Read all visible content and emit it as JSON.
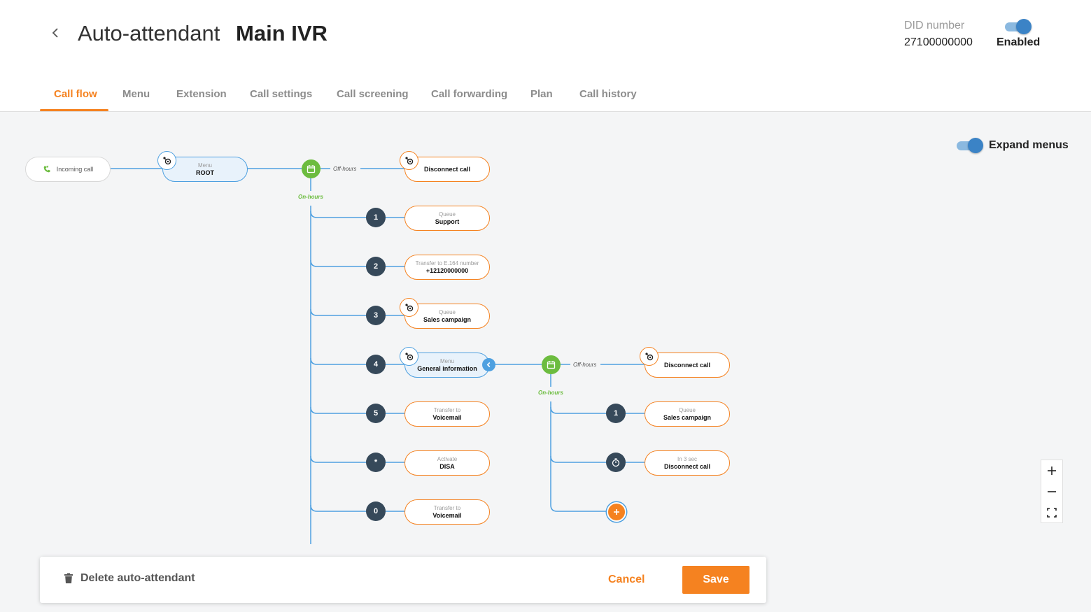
{
  "header": {
    "title": "Auto-attendant",
    "name": "Main IVR",
    "did_label": "DID number",
    "did_value": "27100000000",
    "enabled_label": "Enabled",
    "enabled": true
  },
  "tabs": [
    {
      "label": "Call flow",
      "active": true
    },
    {
      "label": "Menu"
    },
    {
      "label": "Extension"
    },
    {
      "label": "Call settings"
    },
    {
      "label": "Call screening"
    },
    {
      "label": "Call forwarding"
    },
    {
      "label": "Plan"
    },
    {
      "label": "Call history"
    }
  ],
  "flow": {
    "incoming": "Incoming call",
    "root": {
      "type": "Menu",
      "name": "ROOT"
    },
    "off_hours_label": "Off-hours",
    "on_hours_label": "On-hours",
    "root_off_hours": {
      "name": "Disconnect call"
    },
    "root_options": [
      {
        "key": "1",
        "type": "Queue",
        "name": "Support"
      },
      {
        "key": "2",
        "type": "Transfer to E.164 number",
        "name": "+12120000000"
      },
      {
        "key": "3",
        "type": "Queue",
        "name": "Sales campaign"
      },
      {
        "key": "4",
        "type": "Menu",
        "name": "General information"
      },
      {
        "key": "5",
        "type": "Transfer to",
        "name": "Voicemail"
      },
      {
        "key": "*",
        "type": "Activate",
        "name": "DISA"
      },
      {
        "key": "0",
        "type": "Transfer to",
        "name": "Voicemail"
      }
    ],
    "sub_off_hours": {
      "name": "Disconnect call"
    },
    "sub_options": [
      {
        "key": "1",
        "type": "Queue",
        "name": "Sales campaign"
      },
      {
        "key": "timeout-icon",
        "type": "In 3 sec",
        "name": "Disconnect call"
      }
    ]
  },
  "expand_menus_label": "Expand menus",
  "expand_menus": true,
  "footer": {
    "delete_label": "Delete auto-attendant",
    "cancel_label": "Cancel",
    "save_label": "Save"
  },
  "colors": {
    "accent": "#f58220",
    "menu_blue": "#4ea0e0",
    "schedule_green": "#6cbc3f",
    "key_dark": "#36495a",
    "canvas_bg": "#f4f5f6"
  }
}
